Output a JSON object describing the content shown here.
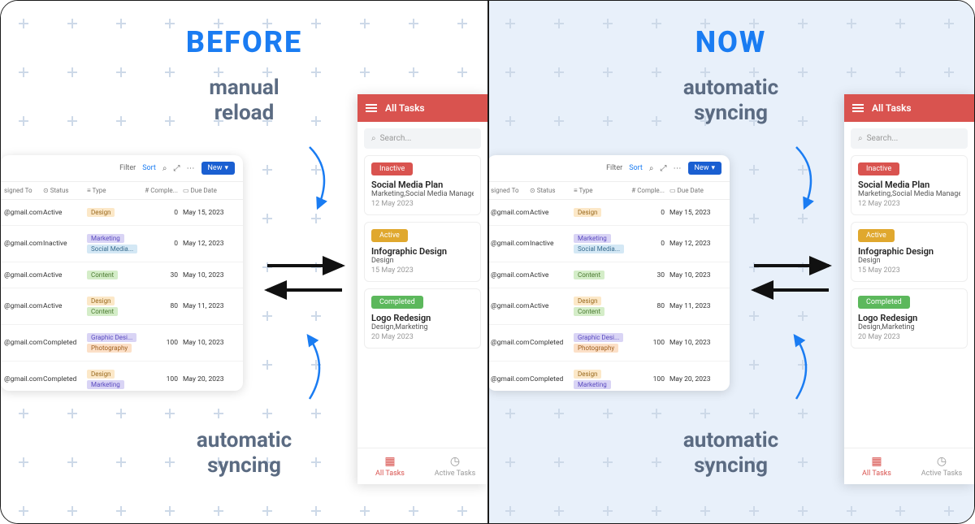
{
  "left": {
    "headline": "BEFORE",
    "captionTop": "manual\nreload",
    "captionBot": "automatic\nsyncing"
  },
  "right": {
    "headline": "NOW",
    "captionTop": "automatic\nsyncing",
    "captionBot": "automatic\nsyncing"
  },
  "toolbar": {
    "filter": "Filter",
    "sort": "Sort",
    "newBtn": "New"
  },
  "columns": {
    "assigned": "signed To",
    "status": "Status",
    "type": "Type",
    "complete": "Comple...",
    "due": "Due Date"
  },
  "rows": [
    {
      "email": "@gmail.com",
      "status": "Active",
      "types": [
        "Design"
      ],
      "complete": "0",
      "due": "May 15, 2023"
    },
    {
      "email": "@gmail.com",
      "status": "Inactive",
      "types": [
        "Marketing",
        "Social Media..."
      ],
      "complete": "0",
      "due": "May 12, 2023"
    },
    {
      "email": "@gmail.com",
      "status": "Active",
      "types": [
        "Content"
      ],
      "complete": "30",
      "due": "May 10, 2023"
    },
    {
      "email": "@gmail.com",
      "status": "Active",
      "types": [
        "Design",
        "Content"
      ],
      "complete": "80",
      "due": "May 11, 2023"
    },
    {
      "email": "@gmail.com",
      "status": "Completed",
      "types": [
        "Graphic Desi...",
        "Photography"
      ],
      "complete": "100",
      "due": "May 10, 2023"
    },
    {
      "email": "@gmail.com",
      "status": "Completed",
      "types": [
        "Design",
        "Marketing"
      ],
      "complete": "100",
      "due": "May 20, 2023"
    }
  ],
  "phone": {
    "title": "All Tasks",
    "searchPlaceholder": "Search...",
    "tasks": [
      {
        "badge": "Inactive",
        "badgeClass": "b-inactive",
        "title": "Social Media Plan",
        "sub": "Marketing,Social Media Management",
        "date": "12 May 2023"
      },
      {
        "badge": "Active",
        "badgeClass": "b-active",
        "title": "Infographic Design",
        "sub": "Design",
        "date": "15 May 2023"
      },
      {
        "badge": "Completed",
        "badgeClass": "b-complete",
        "title": "Logo Redesign",
        "sub": "Design,Marketing",
        "date": "20 May 2023"
      }
    ],
    "nav": {
      "all": "All Tasks",
      "active": "Active Tasks"
    }
  },
  "tagClasses": {
    "Design": "tag-design",
    "Marketing": "tag-mkt",
    "Social Media...": "tag-sm",
    "Content": "tag-content",
    "Graphic Desi...": "tag-gd",
    "Photography": "tag-photo"
  }
}
